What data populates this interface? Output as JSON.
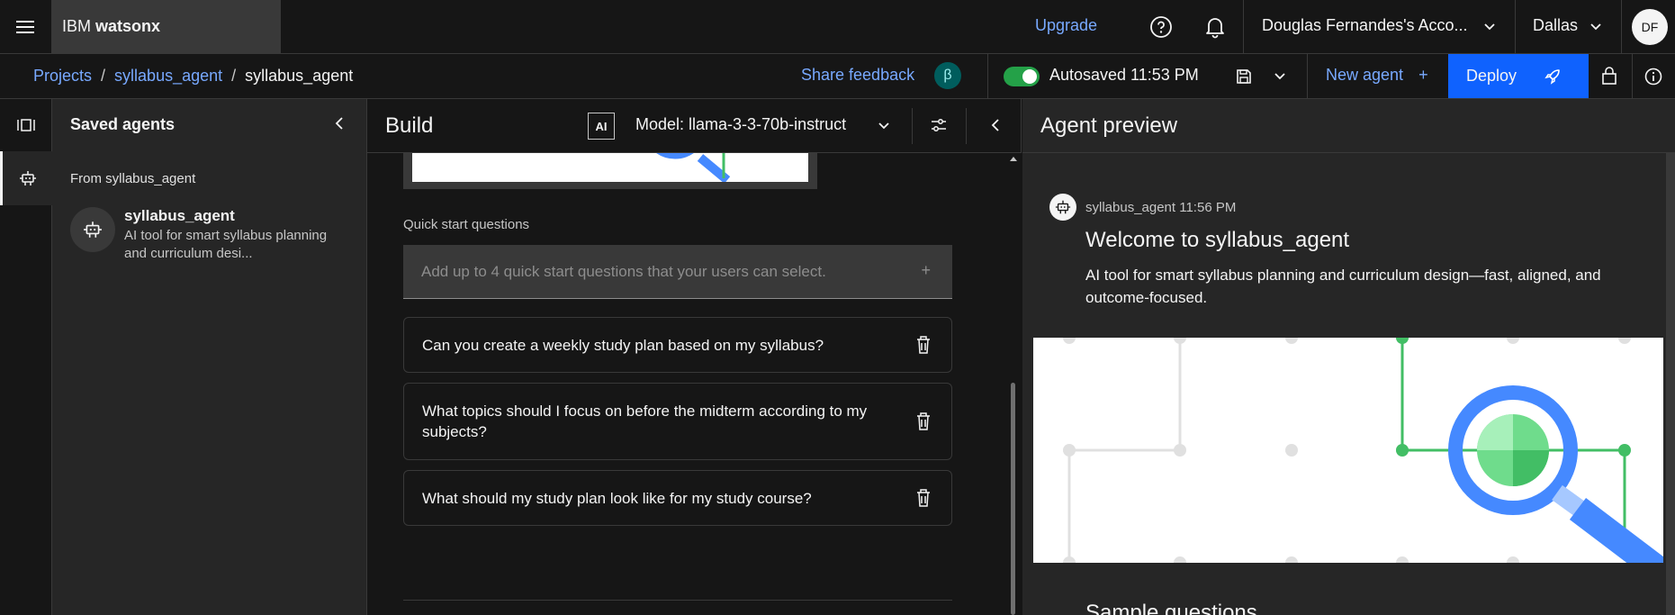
{
  "topbar": {
    "brand_prefix": "IBM",
    "brand_name": "watsonx",
    "upgrade": "Upgrade",
    "account": "Douglas Fernandes's Acco...",
    "region": "Dallas",
    "avatar": "DF"
  },
  "subbar": {
    "breadcrumbs": [
      "Projects",
      "syllabus_agent",
      "syllabus_agent"
    ],
    "separator": "/",
    "share_feedback": "Share feedback",
    "beta": "β",
    "autosaved": "Autosaved 11:53 PM",
    "new_agent": "New agent",
    "plus": "+",
    "deploy": "Deploy"
  },
  "saved_agents": {
    "title": "Saved agents",
    "from_label": "From syllabus_agent",
    "agent_name": "syllabus_agent",
    "agent_desc": "AI tool for smart syllabus planning and curriculum desi..."
  },
  "build": {
    "title": "Build",
    "ai_badge": "AI",
    "model": "Model: llama-3-3-70b-instruct",
    "quick_start_label": "Quick start questions",
    "quick_start_placeholder": "Add up to 4 quick start questions that your users can select.",
    "plus": "+",
    "questions": [
      "Can you create a weekly study plan based on my syllabus?",
      "What topics should I focus on before the midterm according to my subjects?",
      "What should my study plan look like for my study course?"
    ]
  },
  "preview": {
    "title": "Agent preview",
    "bot_meta": "syllabus_agent 11:56 PM",
    "welcome": "Welcome to syllabus_agent",
    "welcome_desc": "AI tool for smart syllabus planning and curriculum design—fast, aligned, and outcome-focused.",
    "sample_questions": "Sample questions"
  },
  "colors": {
    "accent_blue": "#0f62fe",
    "link_blue": "#78a9ff",
    "toggle_green": "#24a148"
  }
}
